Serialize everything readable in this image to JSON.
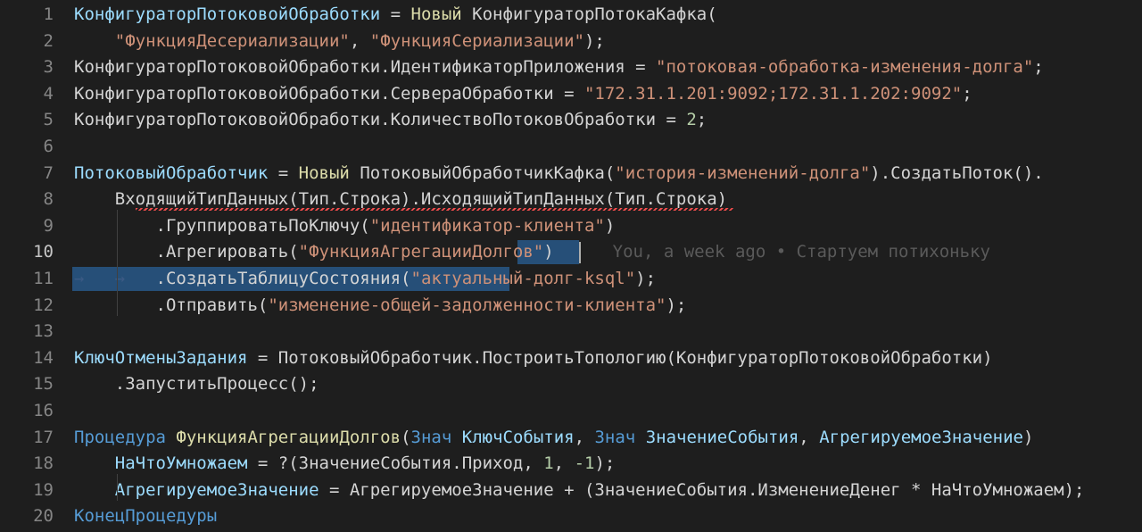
{
  "editor": {
    "current_line": 10,
    "blame_annotation": "You, a week ago • Стартуем потихоньку",
    "lines": [
      {
        "n": "1",
        "tokens": [
          {
            "t": "КонфигураторПотоковойОбработки",
            "c": "var"
          },
          {
            "t": " = ",
            "c": "op"
          },
          {
            "t": "Новый",
            "c": "fn"
          },
          {
            "t": " КонфигураторПотокаКафка(",
            "c": "op"
          }
        ]
      },
      {
        "n": "2",
        "tokens": [
          {
            "t": "    ",
            "c": "op"
          },
          {
            "t": "\"ФункцияДесериализации\"",
            "c": "str"
          },
          {
            "t": ", ",
            "c": "op"
          },
          {
            "t": "\"ФункцияСериализации\"",
            "c": "str"
          },
          {
            "t": ");",
            "c": "op"
          }
        ]
      },
      {
        "n": "3",
        "tokens": [
          {
            "t": "КонфигураторПотоковойОбработки.ИдентификаторПриложения = ",
            "c": "op"
          },
          {
            "t": "\"потоковая-обработка-изменения-долга\"",
            "c": "str"
          },
          {
            "t": ";",
            "c": "op"
          }
        ]
      },
      {
        "n": "4",
        "tokens": [
          {
            "t": "КонфигураторПотоковойОбработки.СервераОбработки = ",
            "c": "op"
          },
          {
            "t": "\"172.31.1.201:9092;172.31.1.202:9092\"",
            "c": "str"
          },
          {
            "t": ";",
            "c": "op"
          }
        ]
      },
      {
        "n": "5",
        "tokens": [
          {
            "t": "КонфигураторПотоковойОбработки.КоличествоПотоковОбработки = ",
            "c": "op"
          },
          {
            "t": "2",
            "c": "num"
          },
          {
            "t": ";",
            "c": "op"
          }
        ]
      },
      {
        "n": "6",
        "tokens": []
      },
      {
        "n": "7",
        "tokens": [
          {
            "t": "ПотоковыйОбработчик",
            "c": "var"
          },
          {
            "t": " = ",
            "c": "op"
          },
          {
            "t": "Новый",
            "c": "fn"
          },
          {
            "t": " ПотоковыйОбработчикКафка(",
            "c": "op"
          },
          {
            "t": "\"история-изменений-долга\"",
            "c": "str"
          },
          {
            "t": ").СоздатьПоток().",
            "c": "op"
          }
        ]
      },
      {
        "n": "8",
        "tokens": [
          {
            "t": "    ВходящийТипДанных(Тип.Строка).ИсходящийТипДанных(Тип.Строка)",
            "c": "op"
          }
        ]
      },
      {
        "n": "9",
        "tokens": [
          {
            "t": "        .ГруппироватьПоКлючу(",
            "c": "op"
          },
          {
            "t": "\"идентификатор-клиента\"",
            "c": "str"
          },
          {
            "t": ")",
            "c": "op"
          }
        ]
      },
      {
        "n": "10",
        "tokens": [
          {
            "t": "        .Агрегировать(",
            "c": "op"
          },
          {
            "t": "\"ФункцияАгрегацииДолгов\"",
            "c": "str"
          },
          {
            "t": ")",
            "c": "op"
          }
        ]
      },
      {
        "n": "11",
        "tokens": [
          {
            "t": "→   →   ",
            "c": "ws"
          },
          {
            "t": ".СоздатьТаблицуСостояния(",
            "c": "op"
          },
          {
            "t": "\"актуальный-долг-ksql\"",
            "c": "str"
          },
          {
            "t": ");",
            "c": "op"
          }
        ]
      },
      {
        "n": "12",
        "tokens": [
          {
            "t": "        .Отправить(",
            "c": "op"
          },
          {
            "t": "\"изменение-общей-задолженности-клиента\"",
            "c": "str"
          },
          {
            "t": ");",
            "c": "op"
          }
        ]
      },
      {
        "n": "13",
        "tokens": []
      },
      {
        "n": "14",
        "tokens": [
          {
            "t": "КлючОтменыЗадания",
            "c": "var"
          },
          {
            "t": " = ПотоковыйОбработчик.ПостроитьТопологию(КонфигураторПотоковойОбработки)",
            "c": "op"
          }
        ]
      },
      {
        "n": "15",
        "tokens": [
          {
            "t": "    .ЗапуститьПроцесс();",
            "c": "op"
          }
        ]
      },
      {
        "n": "16",
        "tokens": []
      },
      {
        "n": "17",
        "tokens": [
          {
            "t": "Процедура",
            "c": "kw"
          },
          {
            "t": " ",
            "c": "op"
          },
          {
            "t": "ФункцияАгрегацииДолгов",
            "c": "fn"
          },
          {
            "t": "(",
            "c": "op"
          },
          {
            "t": "Знач",
            "c": "kw"
          },
          {
            "t": " ",
            "c": "op"
          },
          {
            "t": "КлючСобытия",
            "c": "var"
          },
          {
            "t": ", ",
            "c": "op"
          },
          {
            "t": "Знач",
            "c": "kw"
          },
          {
            "t": " ",
            "c": "op"
          },
          {
            "t": "ЗначениеСобытия",
            "c": "var"
          },
          {
            "t": ", ",
            "c": "op"
          },
          {
            "t": "АгрегируемоеЗначение",
            "c": "var"
          },
          {
            "t": ")",
            "c": "op"
          }
        ]
      },
      {
        "n": "18",
        "tokens": [
          {
            "t": "    ",
            "c": "op"
          },
          {
            "t": "НаЧтоУмножаем",
            "c": "var"
          },
          {
            "t": " = ?(ЗначениеСобытия.Приход, ",
            "c": "op"
          },
          {
            "t": "1",
            "c": "num"
          },
          {
            "t": ", ",
            "c": "op"
          },
          {
            "t": "-1",
            "c": "num"
          },
          {
            "t": ");",
            "c": "op"
          }
        ]
      },
      {
        "n": "19",
        "tokens": [
          {
            "t": "    ",
            "c": "op"
          },
          {
            "t": "АгрегируемоеЗначение",
            "c": "var"
          },
          {
            "t": " = АгрегируемоеЗначение + (ЗначениеСобытия.ИзменениеДенег * НаЧтоУмножаем);",
            "c": "op"
          }
        ]
      },
      {
        "n": "20",
        "tokens": [
          {
            "t": "КонецПроцедуры",
            "c": "kw"
          }
        ]
      }
    ]
  }
}
